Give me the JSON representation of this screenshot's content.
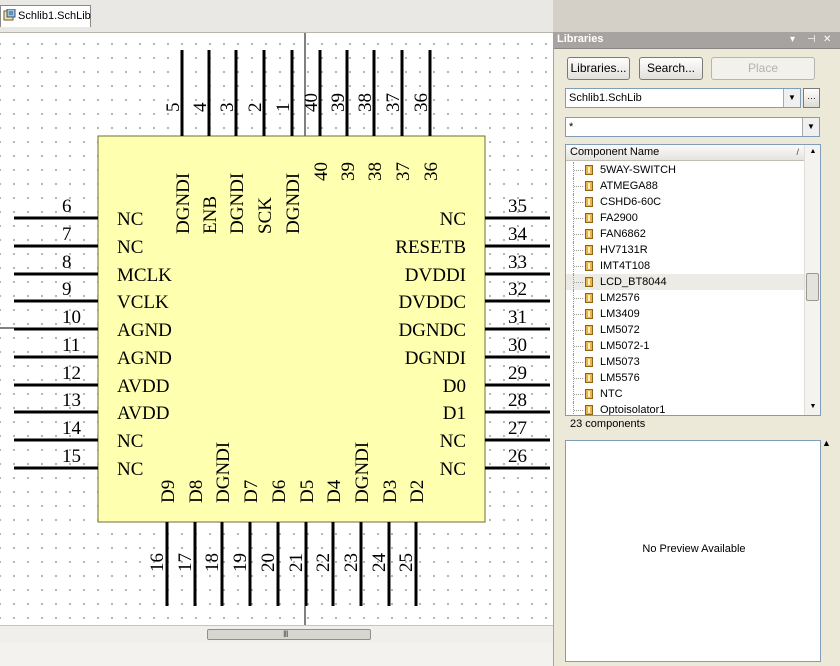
{
  "document_tab": {
    "label": "Schlib1.SchLib"
  },
  "schematic": {
    "top_pins": [
      "5",
      "4",
      "3",
      "2",
      "1",
      "40",
      "39",
      "38",
      "37",
      "36"
    ],
    "top_labels": [
      "DGNDI",
      "ENB",
      "DGNDI",
      "SCK",
      "DGNDI"
    ],
    "top_inner_numbers": [
      "40",
      "39",
      "38",
      "37",
      "36"
    ],
    "left_pins": [
      "6",
      "7",
      "8",
      "9",
      "10",
      "11",
      "12",
      "13",
      "14",
      "15"
    ],
    "left_labels": [
      "NC",
      "NC",
      "MCLK",
      "VCLK",
      "AGND",
      "AGND",
      "AVDD",
      "AVDD",
      "NC",
      "NC"
    ],
    "right_pins": [
      "35",
      "34",
      "33",
      "32",
      "31",
      "30",
      "29",
      "28",
      "27",
      "26"
    ],
    "right_labels": [
      "NC",
      "RESETB",
      "DVDDI",
      "DVDDC",
      "DGNDC",
      "DGNDI",
      "D0",
      "D1",
      "NC",
      "NC"
    ],
    "bottom_pins": [
      "16",
      "17",
      "18",
      "19",
      "20",
      "21",
      "22",
      "23",
      "24",
      "25"
    ],
    "bottom_labels": [
      "D9",
      "D8",
      "DGNDI",
      "D7",
      "D6",
      "D5",
      "D4",
      "DGNDI",
      "D3",
      "D2"
    ],
    "colors": {
      "body_fill": "#ffffb0",
      "body_stroke": "#6e6e3a",
      "pin": "#000000"
    }
  },
  "scrollbar": {
    "grip": "III"
  },
  "panel": {
    "title": "Libraries",
    "header_controls": {
      "menu": "▾",
      "pin": "⊣",
      "close": "✕"
    },
    "buttons": {
      "libraries": "Libraries...",
      "search": "Search...",
      "place": "Place"
    },
    "library_select": {
      "value": "Schlib1.SchLib",
      "more": "…"
    },
    "filter": {
      "value": "*"
    },
    "list": {
      "column_header": "Component Name",
      "sort_indicator": "/",
      "items": [
        "5WAY-SWITCH",
        "ATMEGA88",
        "CSHD6-60C",
        "FA2900",
        "FAN6862",
        "HV7131R",
        "IMT4T108",
        "LCD_BT8044",
        "LM2576",
        "LM3409",
        "LM5072",
        "LM5072-1",
        "LM5073",
        "LM5576",
        "NTC",
        "Optoisolator1"
      ],
      "selected": "LCD_BT8044"
    },
    "count_label": "23 components",
    "preview": {
      "text": "No Preview Available"
    }
  }
}
